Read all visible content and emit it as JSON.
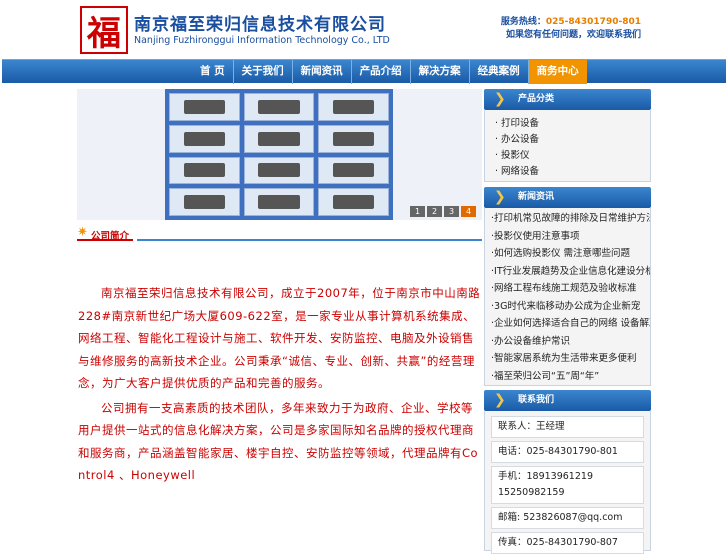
{
  "header": {
    "logo_char": "福",
    "company_cn": "南京福至荣归信息技术有限公司",
    "company_en": "Nanjing Fuzhironggui Information Technology Co., LTD",
    "hotline_label": "服务热线：",
    "hotline_number": "025-84301790-801",
    "hotline_note": "如果您有任何问题，欢迎联系我们"
  },
  "nav": {
    "items": [
      "首 页",
      "关于我们",
      "新闻资讯",
      "产品介绍",
      "解决方案",
      "经典案例",
      "商务中心"
    ],
    "active_index": 6
  },
  "banner": {
    "pager": [
      "1",
      "2",
      "3",
      "4"
    ],
    "active_page": 3
  },
  "intro": {
    "title": "公司简介",
    "paragraphs": [
      "南京福至荣归信息技术有限公司，成立于2007年，位于南京市中山南路228#南京新世纪广场大厦609-622室，是一家专业从事计算机系统集成、网络工程、智能化工程设计与施工、软件开发、安防监控、电脑及外设销售与维修服务的高新技术企业。公司秉承“诚信、专业、创新、共赢”的经营理念，为广大客户提供优质的产品和完善的服务。",
      "公司拥有一支高素质的技术团队，多年来致力于为政府、企业、学校等用户提供一站式的信息化解决方案，公司是多家国际知名品牌的授权代理商和服务商，产品涵盖智能家居、楼宇自控、安防监控等领域，代理品牌有Control4 、Honeywell"
    ]
  },
  "sidebar": {
    "products_title": "产品分类",
    "products": [
      "打印设备",
      "办公设备",
      "投影仪",
      "网络设备"
    ],
    "news_title": "新闻资讯",
    "news": [
      "打印机常见故障的排除及日常维护方法",
      "投影仪使用注意事项",
      "如何选购投影仪 需注意哪些问题",
      "IT行业发展趋势及企业信息化建设分析",
      "网络工程布线施工规范及验收标准",
      "3G时代来临移动办公成为企业新宠",
      "企业如何选择适合自己的网络 设备解决方案",
      "办公设备维护常识",
      "智能家居系统为生活带来更多便利",
      "福至荣归公司“五”周“年”"
    ],
    "contact_title": "联系我们",
    "contact": [
      "联系人：王经理",
      "电话：025-84301790-801",
      "手机：18913961219 15250982159",
      "邮箱: 523826087@qq.com",
      "传真：025-84301790-807"
    ]
  }
}
